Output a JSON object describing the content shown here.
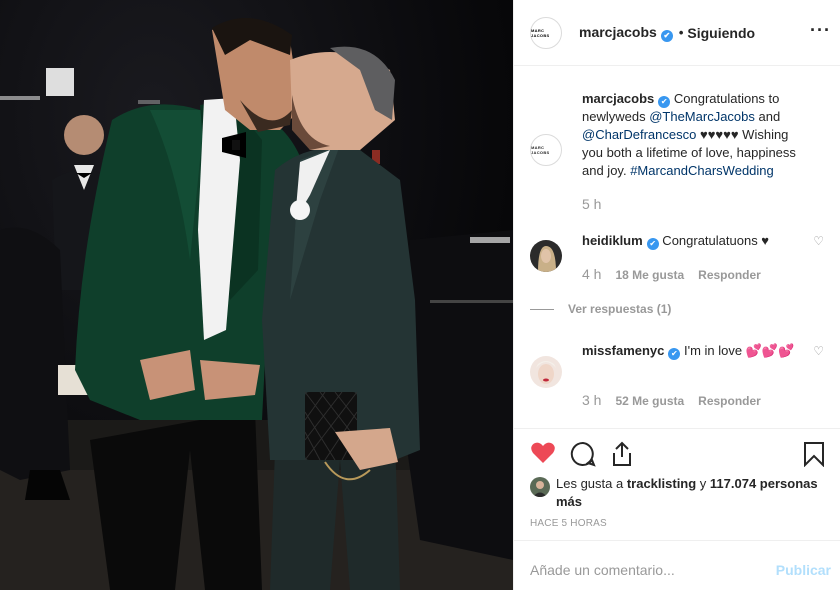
{
  "header": {
    "avatar_text": "MARC JACOBS",
    "username": "marcjacobs",
    "verified": "✔",
    "separator": "•",
    "follow_status": "Siguiendo",
    "more": "···"
  },
  "caption": {
    "username": "marcjacobs",
    "text_1": " Congratulations to newlyweds ",
    "mention_1": "@TheMarcJacobs",
    "text_2": " and ",
    "mention_2": "@CharDefrancesco",
    "text_3": " ♥♥♥♥♥ Wishing you both a lifetime of love, happiness and joy. ",
    "hashtag": "#MarcandCharsWedding",
    "time": "5 h"
  },
  "comments": [
    {
      "username": "heidiklum",
      "text": " Congratulatuons ♥",
      "time": "4 h",
      "likes": "18 Me gusta",
      "reply": "Responder",
      "view_replies": "Ver respuestas (1)"
    },
    {
      "username": "missfamenyc",
      "text": " I'm in love 💕💕💕",
      "time": "3 h",
      "likes": "52 Me gusta",
      "reply": "Responder"
    }
  ],
  "likes": {
    "prefix": "Les gusta a ",
    "user": "tracklisting",
    "mid": " y ",
    "count": "117.074 personas más"
  },
  "posted_ago": "HACE 5 HORAS",
  "comment_input": {
    "placeholder": "Añade un comentario...",
    "publish": "Publicar"
  },
  "colors": {
    "like_red": "#ed4956",
    "verified_blue": "#3897f0",
    "link_blue": "#003569",
    "muted": "#999999",
    "publish_disabled": "#b2dffc"
  },
  "icons": [
    "heart-icon",
    "comment-icon",
    "share-icon",
    "bookmark-icon",
    "more-icon",
    "small-heart-icon"
  ]
}
